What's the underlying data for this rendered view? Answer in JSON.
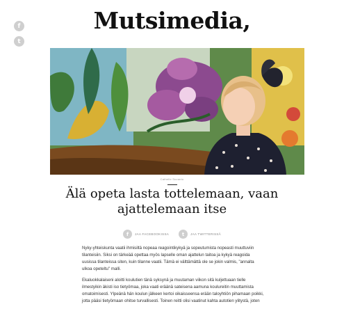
{
  "site": {
    "logo": "Mutsimedia,"
  },
  "sidebar_share": {
    "facebook_icon": "f",
    "twitter_icon": "t"
  },
  "hero": {
    "caption": "Cathelle Suvanto"
  },
  "article": {
    "title": "Älä opeta lasta tottelemaan, vaan ajattelemaan itse",
    "share_facebook": "JAA FACEBOOKISSA",
    "share_twitter": "JAA TWITTERISSÄ",
    "paragraphs": [
      "Nyky-yhteiskunta vaatii ihmisiltä nopeaa reagointikykyä ja sopeutumista nopeasti muuttuviin tilanteisiin. Siksi on tärkeää opettaa myös lapselle oman ajattelun taitoa ja kykyä reagoida uusissa tilanteissa siten, kuin tilanne vaatii. Tämä ei välttämättä ole se jokin valmis, \"annalta ulkoa opeteltu\" malli.",
      "Ekaluokkalaiseni aloitti koulutien tänä syksynä ja muutaman viikon sitä kuljettuaan tielle ilmestyikin äkisti iso tietyömaa, joka vaati eräänä sateisena aamuna koulureitin muuttamista omatoimisesti. Ylpeänä hän koulun jälkeen kertoi oikaisseensa erään taloyhtiön pihamaan poikki, jotta pääsi tietyömaan ohitse turvallisesti. Toinen reitti olisi vaatinut kahta autotien ylitystä, joten"
    ]
  }
}
